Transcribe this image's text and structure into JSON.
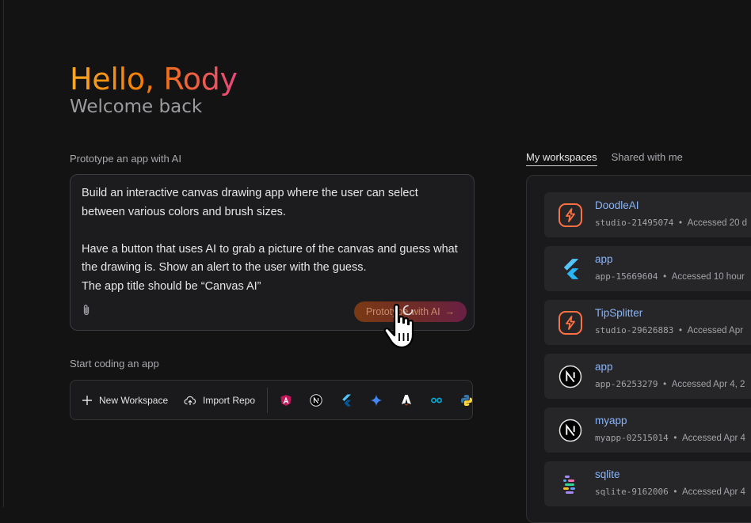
{
  "greeting": "Hello, Rody",
  "welcome": "Welcome back",
  "prototype": {
    "label": "Prototype an app with AI",
    "prompt_text": "Build an interactive canvas drawing app where the user can select between various colors and brush sizes.\n\nHave a button that uses AI to grab a picture of the canvas and guess what the drawing is. Show an alert to the user with the guess.\n The app title should be “Canvas AI”",
    "button_label": "Prototype with AI",
    "button_arrow": "→",
    "attach_icon": "paperclip-icon"
  },
  "coding": {
    "label": "Start coding an app",
    "new_workspace": "New Workspace",
    "import_repo": "Import Repo",
    "templates": [
      "angular-icon",
      "nextjs-icon",
      "flutter-icon",
      "gemini-icon",
      "astro-icon",
      "go-icon",
      "python-icon"
    ],
    "more": "›"
  },
  "tabs": {
    "my": "My workspaces",
    "shared": "Shared with me"
  },
  "workspaces": [
    {
      "name": "DoodleAI",
      "id": "studio-21495074",
      "accessed": "Accessed 20 d",
      "icon": "firebase-studio-icon"
    },
    {
      "name": "app",
      "id": "app-15669604",
      "accessed": "Accessed 10 hour",
      "icon": "flutter-icon"
    },
    {
      "name": "TipSplitter",
      "id": "studio-29626883",
      "accessed": "Accessed Apr",
      "icon": "firebase-studio-icon"
    },
    {
      "name": "app",
      "id": "app-26253279",
      "accessed": "Accessed Apr 4, 2",
      "icon": "nextjs-icon"
    },
    {
      "name": "myapp",
      "id": "myapp-02515014",
      "accessed": "Accessed Apr 4",
      "icon": "nextjs-icon"
    },
    {
      "name": "sqlite",
      "id": "sqlite-9162006",
      "accessed": "Accessed Apr 4",
      "icon": "sqlite-icon"
    }
  ],
  "separator": "•",
  "colors": {
    "background": "#131314",
    "link": "#8ab4f8",
    "greeting_start": "#f9a825",
    "greeting_end": "#e8467c"
  }
}
